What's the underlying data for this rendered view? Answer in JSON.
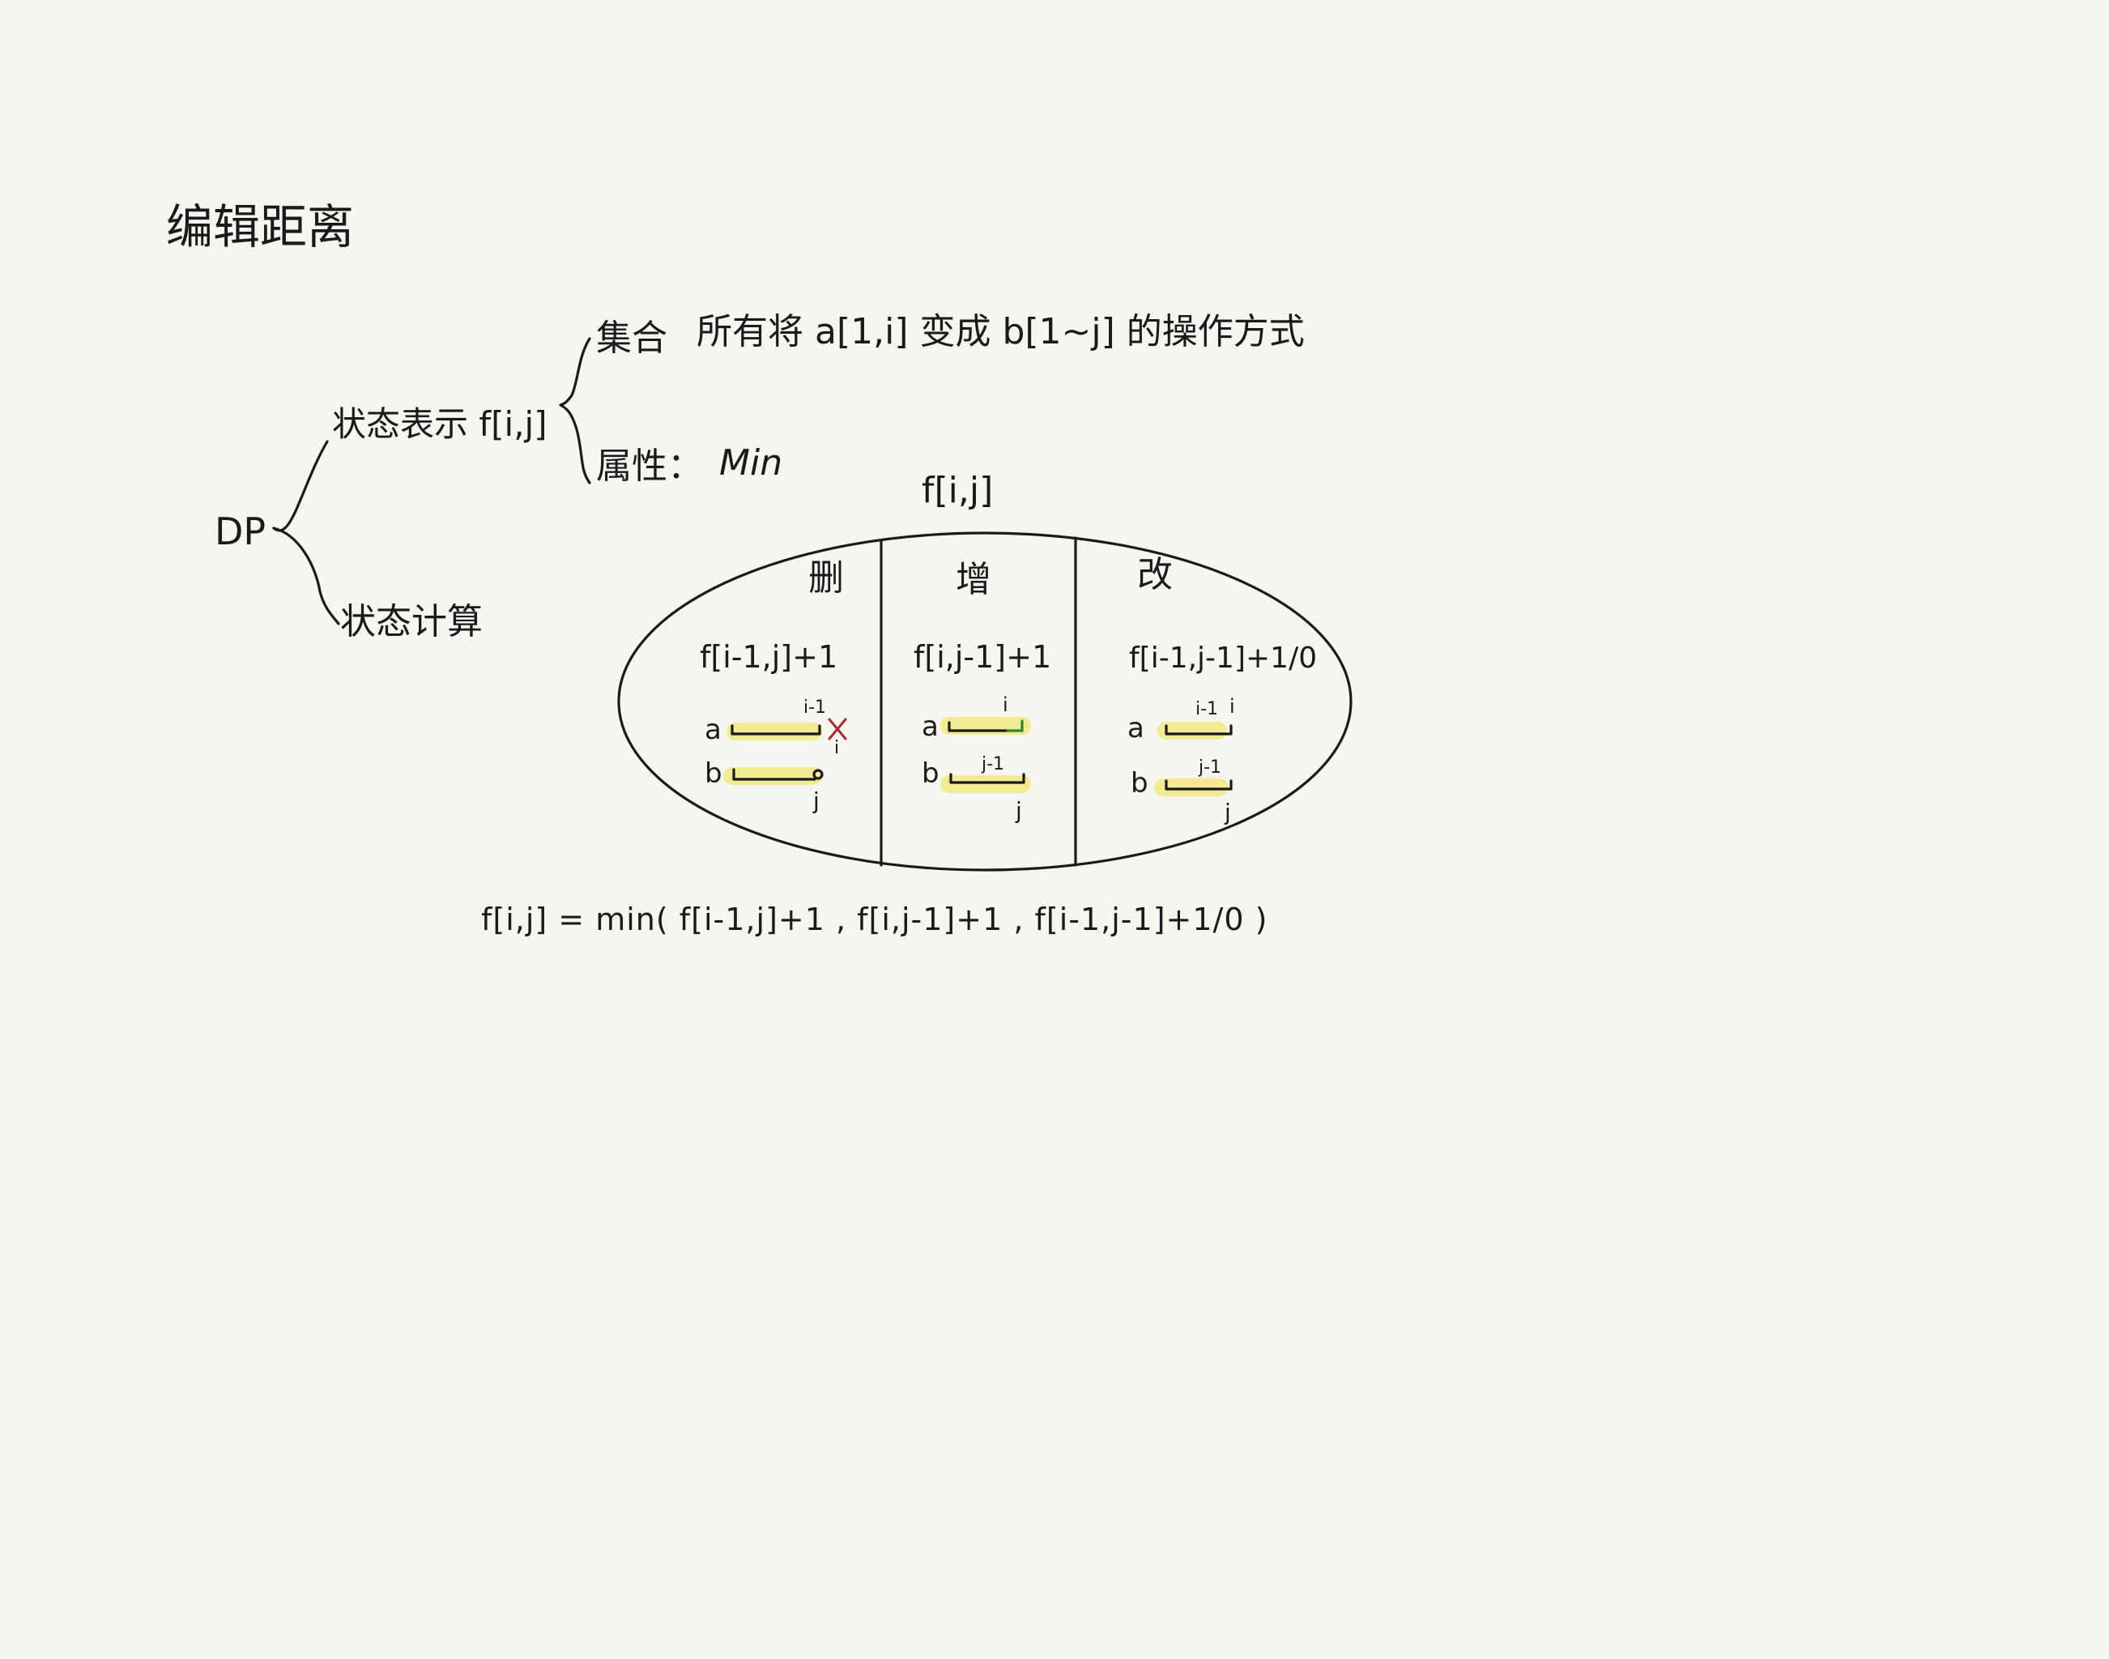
{
  "title": "编辑距离",
  "root": "DP",
  "state_repr": {
    "label": "状态表示 f[i,j]",
    "set_label": "集合",
    "set_desc": "所有将 a[1,i] 变成 b[1~j] 的操作方式",
    "attr_label": "属性：",
    "attr_value": "Min"
  },
  "state_calc": {
    "label": "状态计算"
  },
  "ellipse": {
    "label": "f[i,j]",
    "sections": [
      {
        "op": "删",
        "formula": "f[i-1,j]+1",
        "row_a": "a",
        "row_b": "b",
        "idx_a_top": "i-1",
        "idx_a_bot": "i",
        "idx_b": "j"
      },
      {
        "op": "增",
        "formula": "f[i,j-1]+1",
        "row_a": "a",
        "row_b": "b",
        "idx_a_top": "i",
        "idx_b_top": "j-1",
        "idx_b": "j"
      },
      {
        "op": "改",
        "formula": "f[i-1,j-1]+1/0",
        "row_a": "a",
        "row_b": "b",
        "idx_a_top": "i-1",
        "idx_a_top2": "i",
        "idx_b_top": "j-1",
        "idx_b": "j"
      }
    ]
  },
  "equation": "f[i,j] = min( f[i-1,j]+1 ,  f[i,j-1]+1 ,  f[i-1,j-1]+1/0 )",
  "colors": {
    "background": "#f6f6f1",
    "ink": "#1a1a1a",
    "highlight": "#f3ea86",
    "mark_red": "#b3262d",
    "mark_green": "#2c8a2c"
  }
}
